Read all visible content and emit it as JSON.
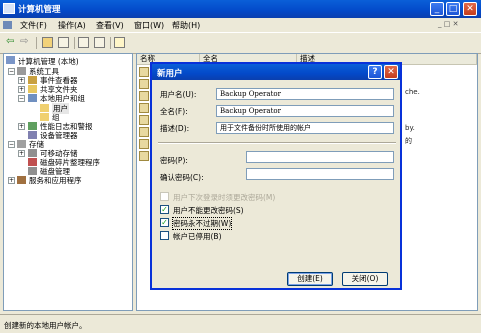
{
  "window": {
    "title": "计算机管理"
  },
  "menubar": {
    "items": [
      "文件(F)",
      "操作(A)",
      "查看(V)",
      "窗口(W)",
      "帮助(H)"
    ]
  },
  "tree": {
    "root": "计算机管理 (本地)",
    "system_tools": "系统工具",
    "event_viewer": "事件查看器",
    "shared_folders": "共享文件夹",
    "local_users_groups": "本地用户和组",
    "users": "用户",
    "groups": "组",
    "perf_logs": "性能日志和警报",
    "device_manager": "设备管理器",
    "storage": "存储",
    "removable_storage": "可移动存储",
    "defrag": "磁盘碎片整理程序",
    "disk_mgmt": "磁盘管理",
    "services": "服务和应用程序"
  },
  "list": {
    "col_name": "名称",
    "col_fullname": "全名",
    "col_desc": "描述",
    "fragments": [
      "che.",
      "by.",
      "的"
    ]
  },
  "dialog": {
    "title": "新用户",
    "username_label": "用户名(U):",
    "username_value": "Backup Operator",
    "fullname_label": "全名(F):",
    "fullname_value": "Backup Operator",
    "desc_label": "描述(D):",
    "desc_value": "用于文件备份时所使用的帐户",
    "password_label": "密码(P):",
    "confirm_label": "确认密码(C):",
    "chk_must_change": "用户下次登录时须更改密码(M)",
    "chk_cannot_change": "用户不能更改密码(S)",
    "chk_never_expires": "密码永不过期(W)",
    "chk_disabled": "帐户已停用(B)",
    "create_button": "创建(E)",
    "close_button": "关闭(O)",
    "help_glyph": "?",
    "close_glyph": "✕"
  },
  "status": {
    "text": "创建新的本地用户帐户。"
  }
}
